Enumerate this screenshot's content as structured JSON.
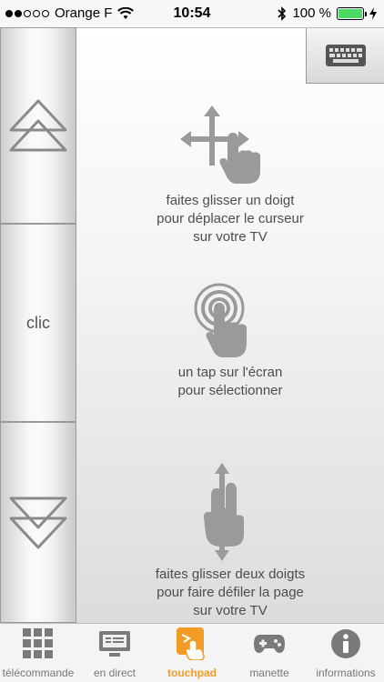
{
  "status_bar": {
    "carrier": "Orange F",
    "time": "10:54",
    "battery": "100 %",
    "signal_level": 2
  },
  "side_buttons": {
    "up_icon": "double-chevron-up-icon",
    "clic_label": "clic",
    "down_icon": "double-chevron-down-icon"
  },
  "touchpad": {
    "keyboard_icon": "keyboard-icon",
    "hints": [
      {
        "icon": "swipe-move-hand-icon",
        "lines": [
          "faites glisser un doigt",
          "pour déplacer le curseur",
          "sur votre TV"
        ]
      },
      {
        "icon": "tap-hand-icon",
        "lines": [
          "un tap sur l'écran",
          "pour sélectionner"
        ]
      },
      {
        "icon": "two-finger-scroll-hand-icon",
        "lines": [
          "faites glisser deux doigts",
          "pour faire défiler la page",
          "sur votre TV"
        ]
      }
    ]
  },
  "tabbar": {
    "tabs": [
      {
        "label": "télécommande",
        "icon": "grid-icon",
        "active": false
      },
      {
        "label": "en direct",
        "icon": "tv-icon",
        "active": false
      },
      {
        "label": "touchpad",
        "icon": "touchpad-icon",
        "active": true
      },
      {
        "label": "manette",
        "icon": "gamepad-icon",
        "active": false
      },
      {
        "label": "informations",
        "icon": "info-icon",
        "active": false
      }
    ]
  },
  "colors": {
    "accent": "#f39c25",
    "battery": "#4cd964",
    "hint_icon": "#9a9a9a"
  }
}
